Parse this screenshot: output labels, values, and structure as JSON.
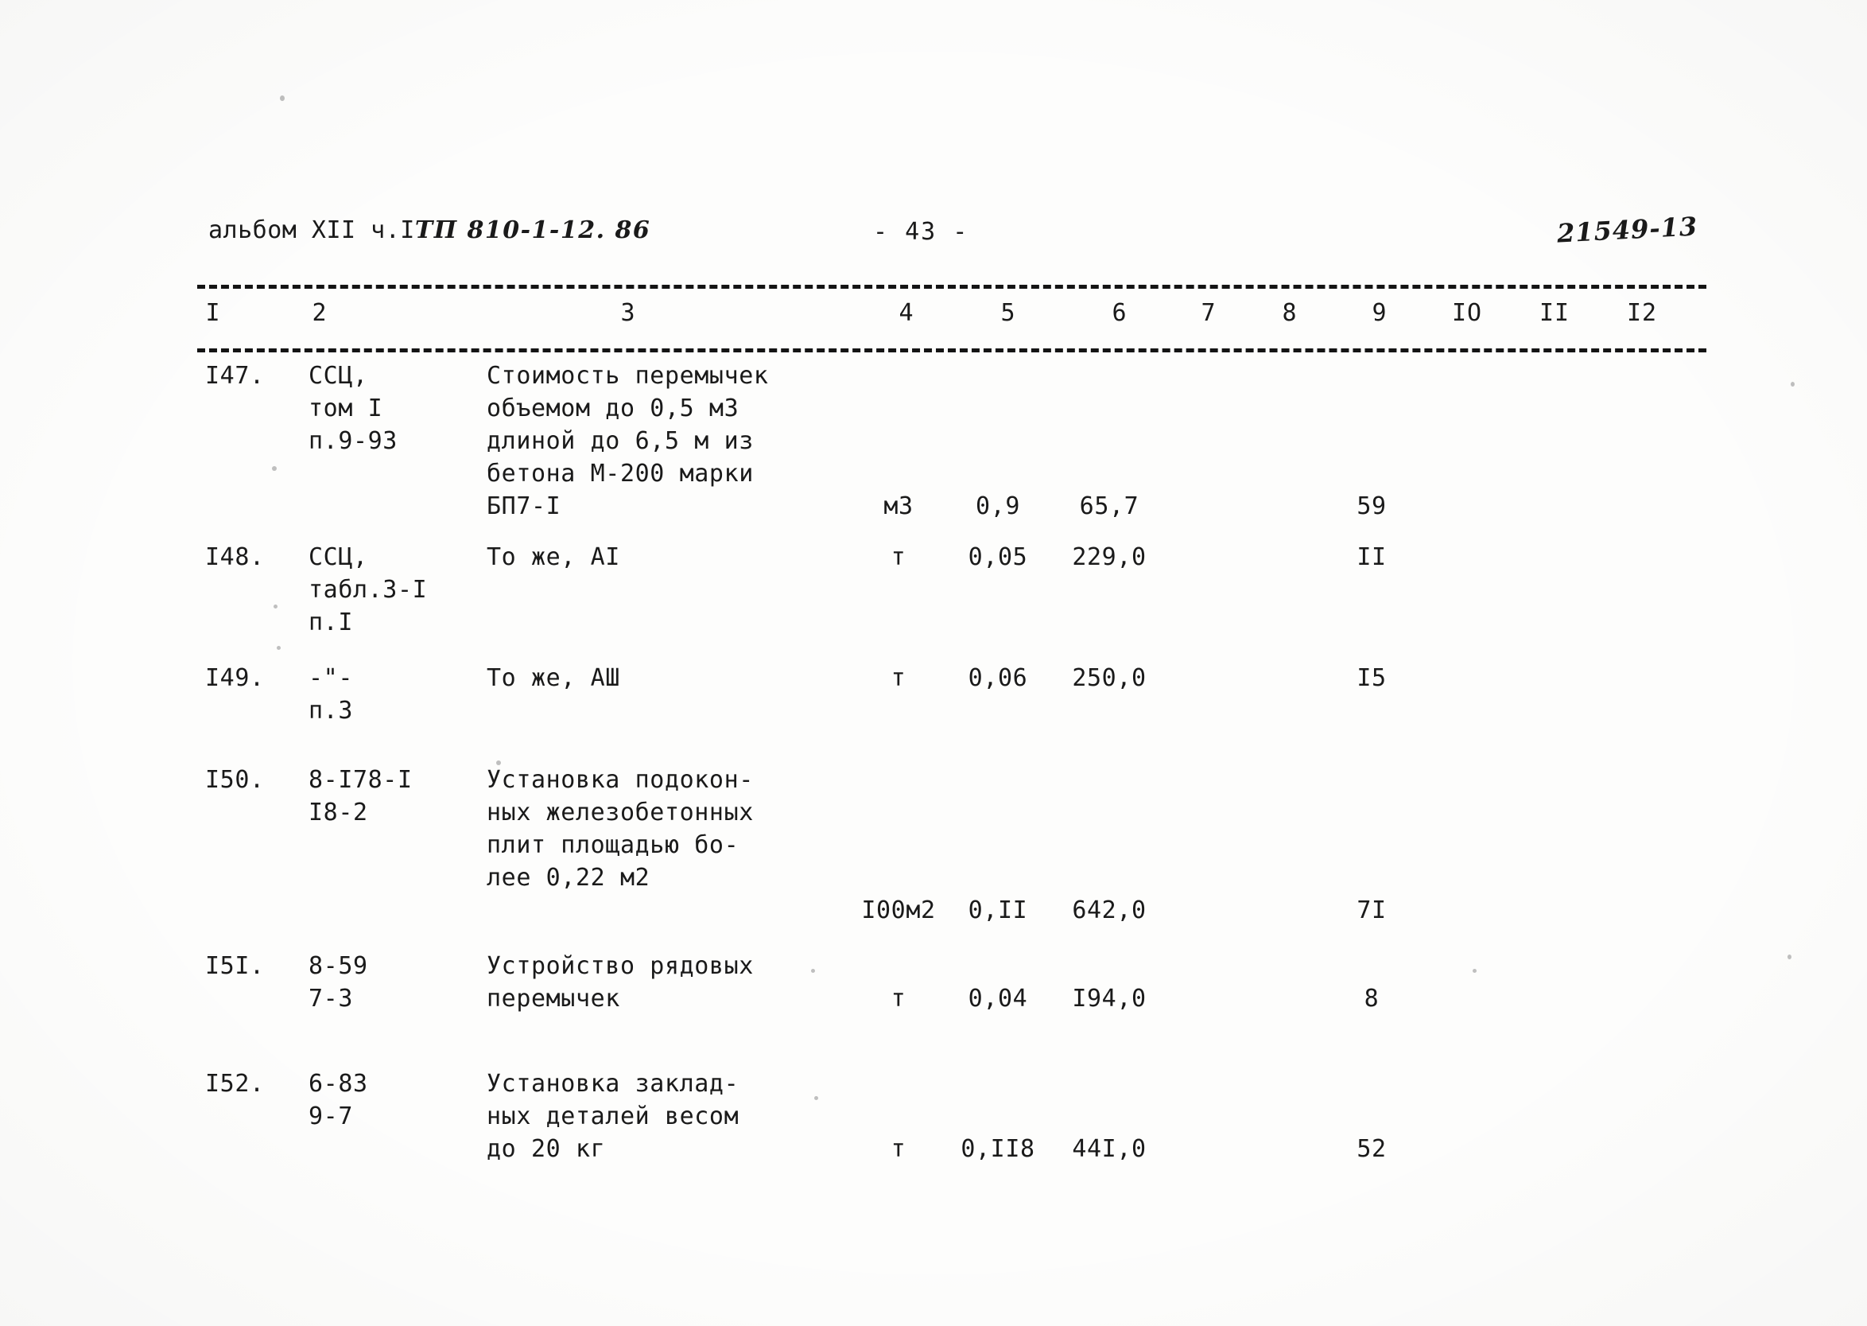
{
  "header": {
    "album_label": "альбом XII ч.I",
    "project_code": "ТП 810-1-12. 86",
    "page_number": "- 43 -",
    "archive_stamp": "21549-13"
  },
  "table": {
    "column_headers": [
      "I",
      "2",
      "3",
      "4",
      "5",
      "6",
      "7",
      "8",
      "9",
      "IO",
      "II",
      "I2"
    ],
    "rows": [
      {
        "c1": "I47.",
        "c2": "ССЦ,\nтом I\nп.9-93",
        "c3": "Стоимость перемычек\nобъемом до 0,5 м3\nдлиной до 6,5 м из\nбетона М-200 марки\nБП7-I",
        "c4": "м3",
        "c5": "0,9",
        "c6": "65,7",
        "c7": "",
        "c8": "",
        "c9": "59",
        "c10": "",
        "c11": "",
        "c12": ""
      },
      {
        "c1": "I48.",
        "c2": "ССЦ,\nтабл.3-I\nп.I",
        "c3": "То же, АI",
        "c4": "т",
        "c5": "0,05",
        "c6": "229,0",
        "c7": "",
        "c8": "",
        "c9": "II",
        "c10": "",
        "c11": "",
        "c12": ""
      },
      {
        "c1": "I49.",
        "c2": "-\"-\nп.3",
        "c3": "То же, АШ",
        "c4": "т",
        "c5": "0,06",
        "c6": "250,0",
        "c7": "",
        "c8": "",
        "c9": "I5",
        "c10": "",
        "c11": "",
        "c12": ""
      },
      {
        "c1": "I50.",
        "c2": "8-I78-I\nI8-2",
        "c3": "Установка подокон-\nных железобетонных\nплит площадью бо-\nлее 0,22 м2",
        "c4": "I00м2",
        "c5": "0,II",
        "c6": "642,0",
        "c7": "",
        "c8": "",
        "c9": "7I",
        "c10": "",
        "c11": "",
        "c12": ""
      },
      {
        "c1": "I5I.",
        "c2": "8-59\n7-3",
        "c3": "Устройство рядовых\nперемычек",
        "c4": "т",
        "c5": "0,04",
        "c6": "I94,0",
        "c7": "",
        "c8": "",
        "c9": "8",
        "c10": "",
        "c11": "",
        "c12": ""
      },
      {
        "c1": "I52.",
        "c2": "6-83\n9-7",
        "c3": "Установка заклад-\nных деталей весом\nдо 20 кг",
        "c4": "т",
        "c5": "0,II8",
        "c6": "44I,0",
        "c7": "",
        "c8": "",
        "c9": "52",
        "c10": "",
        "c11": "",
        "c12": ""
      }
    ]
  }
}
